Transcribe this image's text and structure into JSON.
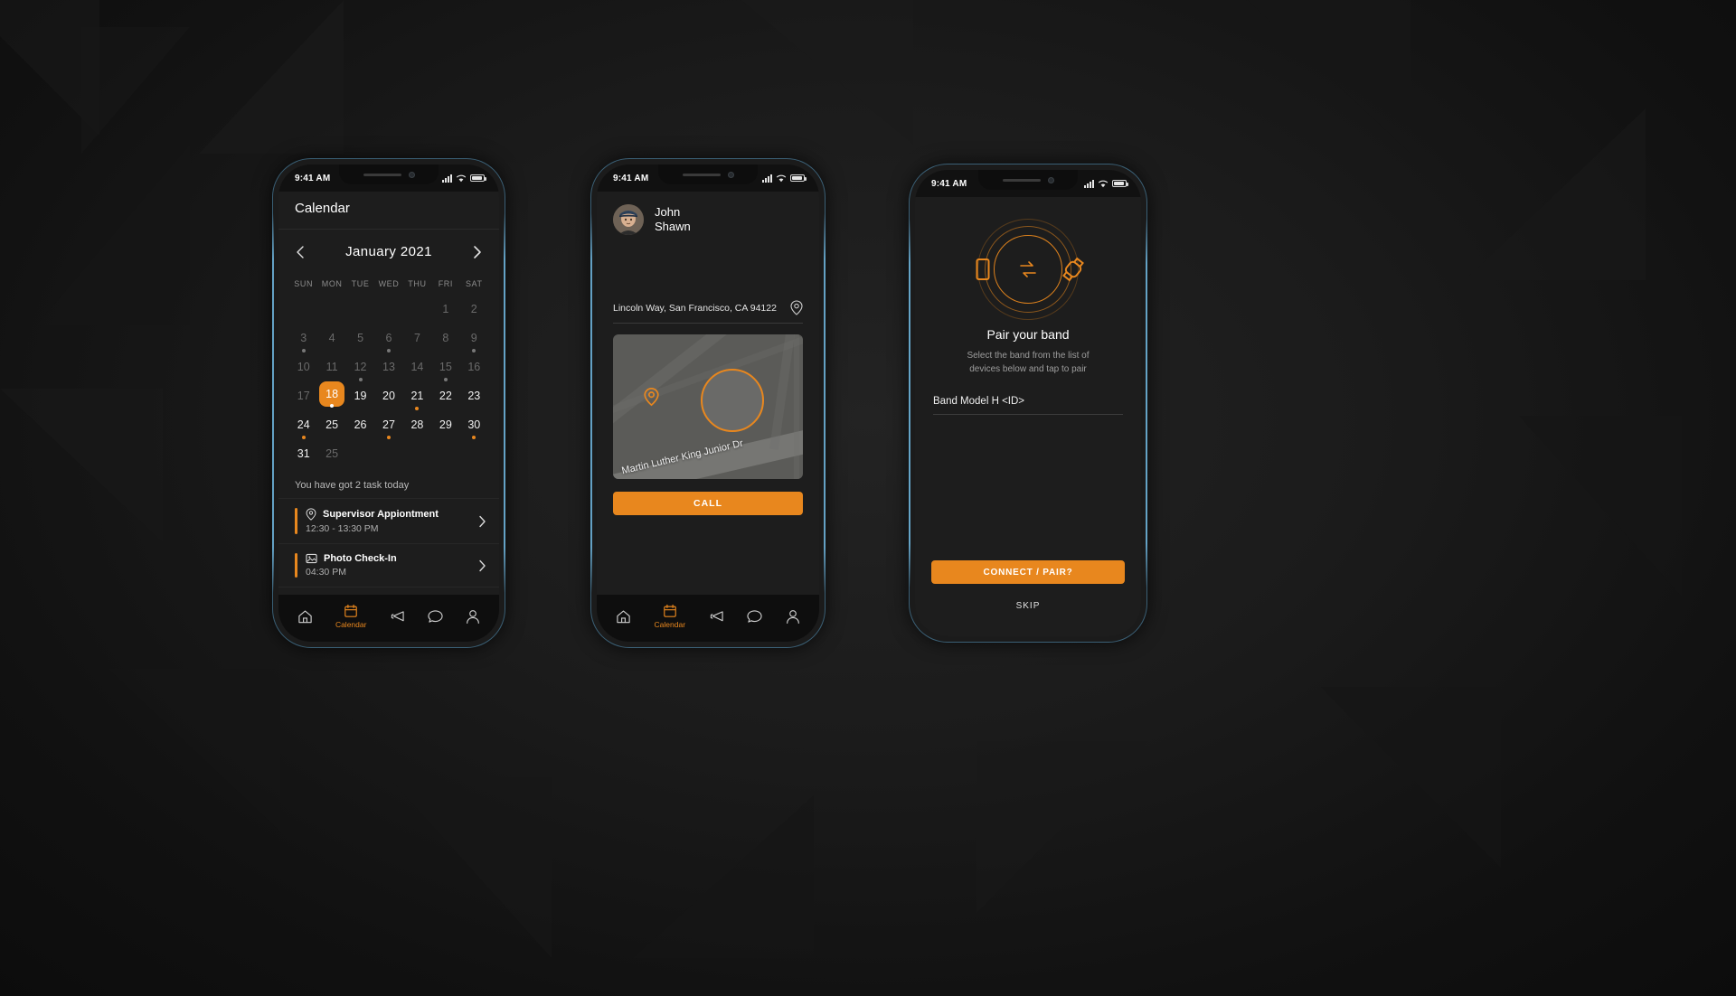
{
  "background": {
    "base_color": "#141414",
    "accent": "#e8871e",
    "frame_glow": "#5da0c8"
  },
  "phone1": {
    "status": {
      "time": "9:41 AM",
      "signal_icon": "signal-bars-icon",
      "wifi_icon": "wifi-icon",
      "battery_icon": "battery-icon"
    },
    "title": "Calendar",
    "calendar": {
      "prev_icon": "chevron-left-icon",
      "next_icon": "chevron-right-icon",
      "month_label": "January  2021",
      "weekdays": [
        "SUN",
        "MON",
        "TUE",
        "WED",
        "THU",
        "FRI",
        "SAT"
      ],
      "weeks": [
        [
          {
            "d": "",
            "state": "empty"
          },
          {
            "d": "",
            "state": "empty"
          },
          {
            "d": "",
            "state": "empty"
          },
          {
            "d": "",
            "state": "empty"
          },
          {
            "d": "",
            "state": "empty"
          },
          {
            "d": "1",
            "state": "dim"
          },
          {
            "d": "2",
            "state": "dim"
          }
        ],
        [
          {
            "d": "3",
            "state": "dim",
            "dot": "grey"
          },
          {
            "d": "4",
            "state": "dim"
          },
          {
            "d": "5",
            "state": "dim"
          },
          {
            "d": "6",
            "state": "dim",
            "dot": "grey"
          },
          {
            "d": "7",
            "state": "dim"
          },
          {
            "d": "8",
            "state": "dim"
          },
          {
            "d": "9",
            "state": "dim",
            "dot": "grey"
          }
        ],
        [
          {
            "d": "10",
            "state": "dim"
          },
          {
            "d": "11",
            "state": "dim"
          },
          {
            "d": "12",
            "state": "dim",
            "dot": "grey"
          },
          {
            "d": "13",
            "state": "dim"
          },
          {
            "d": "14",
            "state": "dim"
          },
          {
            "d": "15",
            "state": "dim",
            "dot": "grey"
          },
          {
            "d": "16",
            "state": "dim"
          }
        ],
        [
          {
            "d": "17",
            "state": "dim"
          },
          {
            "d": "18",
            "state": "selected",
            "dot": "white"
          },
          {
            "d": "19",
            "state": "normal"
          },
          {
            "d": "20",
            "state": "normal"
          },
          {
            "d": "21",
            "state": "normal",
            "dot": "orange"
          },
          {
            "d": "22",
            "state": "normal"
          },
          {
            "d": "23",
            "state": "normal"
          }
        ],
        [
          {
            "d": "24",
            "state": "normal",
            "dot": "orange"
          },
          {
            "d": "25",
            "state": "normal"
          },
          {
            "d": "26",
            "state": "normal"
          },
          {
            "d": "27",
            "state": "normal",
            "dot": "orange"
          },
          {
            "d": "28",
            "state": "normal"
          },
          {
            "d": "29",
            "state": "normal"
          },
          {
            "d": "30",
            "state": "normal",
            "dot": "orange"
          }
        ],
        [
          {
            "d": "31",
            "state": "normal"
          },
          {
            "d": "25",
            "state": "dim"
          },
          {
            "d": "",
            "state": "empty"
          },
          {
            "d": "",
            "state": "empty"
          },
          {
            "d": "",
            "state": "empty"
          },
          {
            "d": "",
            "state": "empty"
          },
          {
            "d": "",
            "state": "empty"
          }
        ]
      ]
    },
    "tasks_header": "You have got 2 task today",
    "tasks": [
      {
        "icon": "location-pin-icon",
        "title": "Supervisor Appiontment",
        "time": "12:30 - 13:30 PM",
        "arrow_icon": "chevron-right-icon"
      },
      {
        "icon": "photo-icon",
        "title": "Photo Check-In",
        "time": "04:30 PM",
        "arrow_icon": "chevron-right-icon"
      }
    ],
    "nav": [
      {
        "icon": "home-icon",
        "label": "",
        "active": false
      },
      {
        "icon": "calendar-icon",
        "label": "Calendar",
        "active": true
      },
      {
        "icon": "megaphone-icon",
        "label": "",
        "active": false
      },
      {
        "icon": "chat-icon",
        "label": "",
        "active": false
      },
      {
        "icon": "person-icon",
        "label": "",
        "active": false
      }
    ]
  },
  "phone2": {
    "status": {
      "time": "9:41 AM",
      "signal_icon": "signal-bars-icon",
      "wifi_icon": "wifi-icon",
      "battery_icon": "battery-icon"
    },
    "profile": {
      "avatar": "user-avatar",
      "first_name": "John",
      "last_name": "Shawn"
    },
    "address": "Lincoln Way, San Francisco, CA 94122",
    "address_icon": "location-pin-icon",
    "map": {
      "street_label": "Martin Luther King Junior Dr",
      "marker_icon": "map-marker-icon"
    },
    "call_label": "CALL",
    "nav": [
      {
        "icon": "home-icon",
        "label": "",
        "active": false
      },
      {
        "icon": "calendar-icon",
        "label": "Calendar",
        "active": true
      },
      {
        "icon": "megaphone-icon",
        "label": "",
        "active": false
      },
      {
        "icon": "chat-icon",
        "label": "",
        "active": false
      },
      {
        "icon": "person-icon",
        "label": "",
        "active": false
      }
    ]
  },
  "phone3": {
    "status": {
      "time": "9:41 AM",
      "signal_icon": "signal-bars-icon",
      "wifi_icon": "wifi-icon",
      "battery_icon": "battery-icon"
    },
    "pair_graphic": {
      "phone_icon": "mobile-phone-icon",
      "sync_icon": "sync-arrows-icon",
      "watch_icon": "smart-band-icon"
    },
    "title": "Pair your band",
    "subtitle": "Select the band from the list of devices below and tap to pair",
    "device": "Band Model H <ID>",
    "connect_label": "CONNECT / PAIR?",
    "skip_label": "SKIP"
  }
}
